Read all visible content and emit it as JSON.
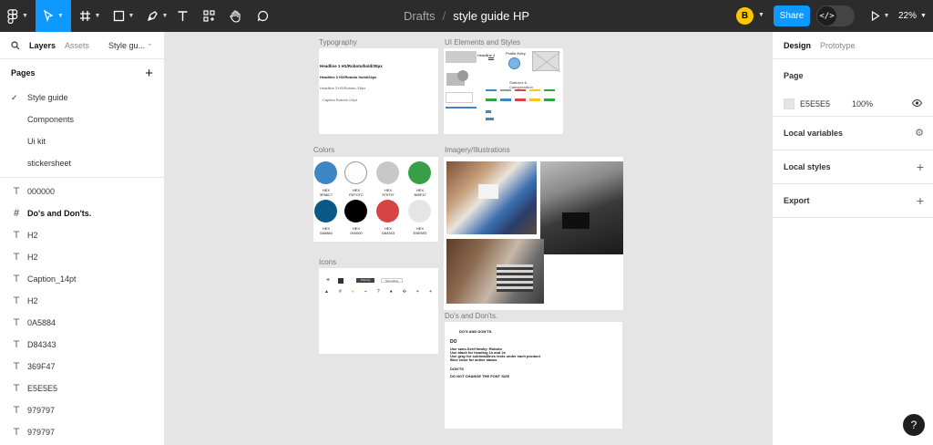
{
  "toolbar": {
    "breadcrumb_root": "Drafts",
    "breadcrumb_sep": "/",
    "file_name": "style guide HP",
    "avatar_initial": "B",
    "share_label": "Share",
    "dev_mode_glyph": "</>",
    "zoom": "22%",
    "tools": [
      "figma-menu-icon",
      "move-tool-icon",
      "frame-tool-icon",
      "shape-tool-icon",
      "pen-tool-icon",
      "text-tool-icon",
      "resources-icon",
      "hand-tool-icon",
      "comment-icon"
    ]
  },
  "left": {
    "tab_layers": "Layers",
    "tab_assets": "Assets",
    "page_selector": "Style gu...",
    "pages_title": "Pages",
    "pages": [
      {
        "label": "Style guide",
        "selected": true
      },
      {
        "label": "Components",
        "selected": false
      },
      {
        "label": "Ui kit",
        "selected": false
      },
      {
        "label": "stickersheet",
        "selected": false
      }
    ],
    "layers": [
      {
        "label": "000000",
        "icon": "text-layer-icon"
      },
      {
        "label": "Do's and Don'ts.",
        "icon": "frame-layer-icon"
      },
      {
        "label": "H2",
        "icon": "text-layer-icon"
      },
      {
        "label": "H2",
        "icon": "text-layer-icon"
      },
      {
        "label": "Caption_14pt",
        "icon": "text-layer-icon"
      },
      {
        "label": "H2",
        "icon": "text-layer-icon"
      },
      {
        "label": "0A5884",
        "icon": "text-layer-icon"
      },
      {
        "label": "D84343",
        "icon": "text-layer-icon"
      },
      {
        "label": "369F47",
        "icon": "text-layer-icon"
      },
      {
        "label": "E5E5E5",
        "icon": "text-layer-icon"
      },
      {
        "label": "979797",
        "icon": "text-layer-icon"
      },
      {
        "label": "979797",
        "icon": "text-layer-icon"
      }
    ]
  },
  "right": {
    "tab_design": "Design",
    "tab_prototype": "Prototype",
    "page_title": "Page",
    "page_color": "E5E5E5",
    "page_opacity": "100%",
    "local_variables": "Local variables",
    "local_styles": "Local styles",
    "export": "Export"
  },
  "canvas": {
    "typography": {
      "label": "Typography",
      "h1": "Headline 1   H1/Roboto/bold/30px",
      "h2": "Headline 2   H2/Roboto /bold/24px",
      "h3": "Headline 3     H3/Roboto /18px",
      "caption": "Caption         Roboto /14pt"
    },
    "ui_elements": {
      "label": "UI Elements and Styles",
      "headline": "Headline 4",
      "profile": "Profile Entry",
      "statuses": "Statuses &",
      "categorization": "Categorization"
    },
    "colors": {
      "label": "Colors",
      "hex_label": "HEX",
      "swatches": [
        {
          "hex": "3F86C7",
          "color": "#3f86c7"
        },
        {
          "hex": "FEFCFC",
          "color": "#fefcfc"
        },
        {
          "hex": "979797",
          "color": "#c8c8c8"
        },
        {
          "hex": "369F47",
          "color": "#369f47"
        },
        {
          "hex": "0A5884",
          "color": "#0a5884"
        },
        {
          "hex": "000000",
          "color": "#000000"
        },
        {
          "hex": "D84343",
          "color": "#d84343"
        },
        {
          "hex": "E5E5E5",
          "color": "#e5e5e5"
        }
      ]
    },
    "imagery": {
      "label": "Imagery/Illustrations"
    },
    "icons": {
      "label": "Icons",
      "primary": "Primary",
      "secondary": "Secondary"
    },
    "dos": {
      "label": "Do's and Don'ts.",
      "title": "DO'S AND DON'TS.",
      "do": "DO",
      "do_lines": [
        "Use sans-Serif family: Roboto",
        "Use black for heading 1s and 2s",
        "Use gray for subheadlines texts under each product",
        "Blue color for active status"
      ],
      "dont": "DON'TS",
      "dont_lines": [
        "DO NOT CHANGE THE FONT SIZE"
      ]
    }
  },
  "help": "?"
}
